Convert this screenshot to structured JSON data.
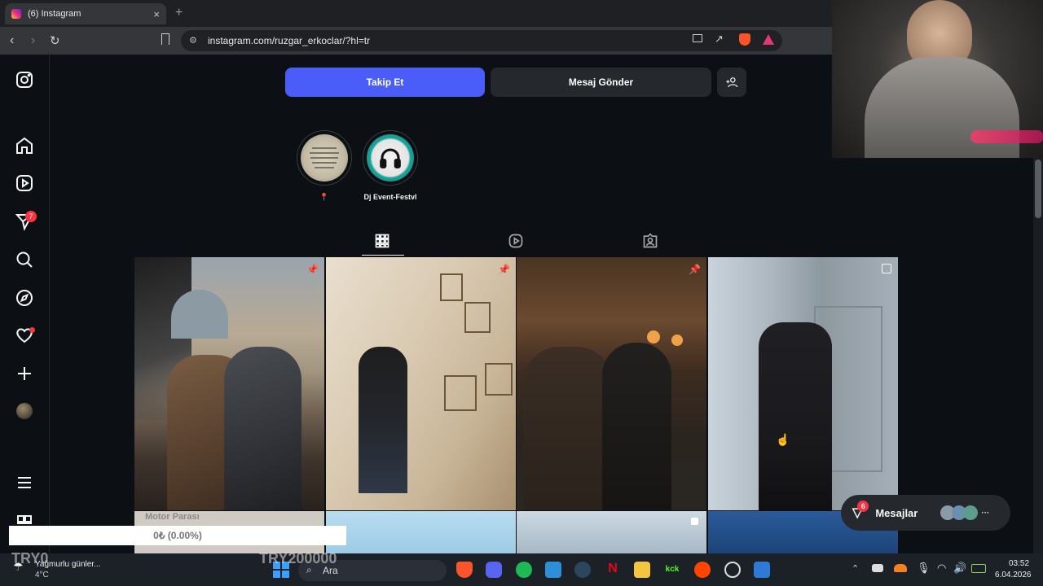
{
  "browser": {
    "tab_title": "(6) Instagram",
    "tab_close": "×",
    "new_tab": "+",
    "url": "instagram.com/ruzgar_erkoclar/?hl=tr"
  },
  "sidebar": {
    "notifications_badge": "7"
  },
  "profile": {
    "follow_label": "Takip Et",
    "message_label": "Mesaj Gönder",
    "highlights": [
      {
        "label": "📍"
      },
      {
        "label": "Dj Event-Festvl"
      }
    ]
  },
  "messages_panel": {
    "label": "Mesajlar",
    "badge": "6",
    "more": "···"
  },
  "overlays": {
    "motor_parasi": "Motor Parası",
    "progress_text": "0₺ (0.00%)",
    "try0": "TRY0",
    "try200000": "TRY200000"
  },
  "taskbar": {
    "weather_text": "Yağmurlu günler...",
    "weather_temp": "4°C",
    "search_placeholder": "Ara",
    "time": "03:52",
    "date": "6.04.2026"
  },
  "colors": {
    "accent": "#4a5df9",
    "background": "#0c1014",
    "badge": "#ff3040"
  }
}
